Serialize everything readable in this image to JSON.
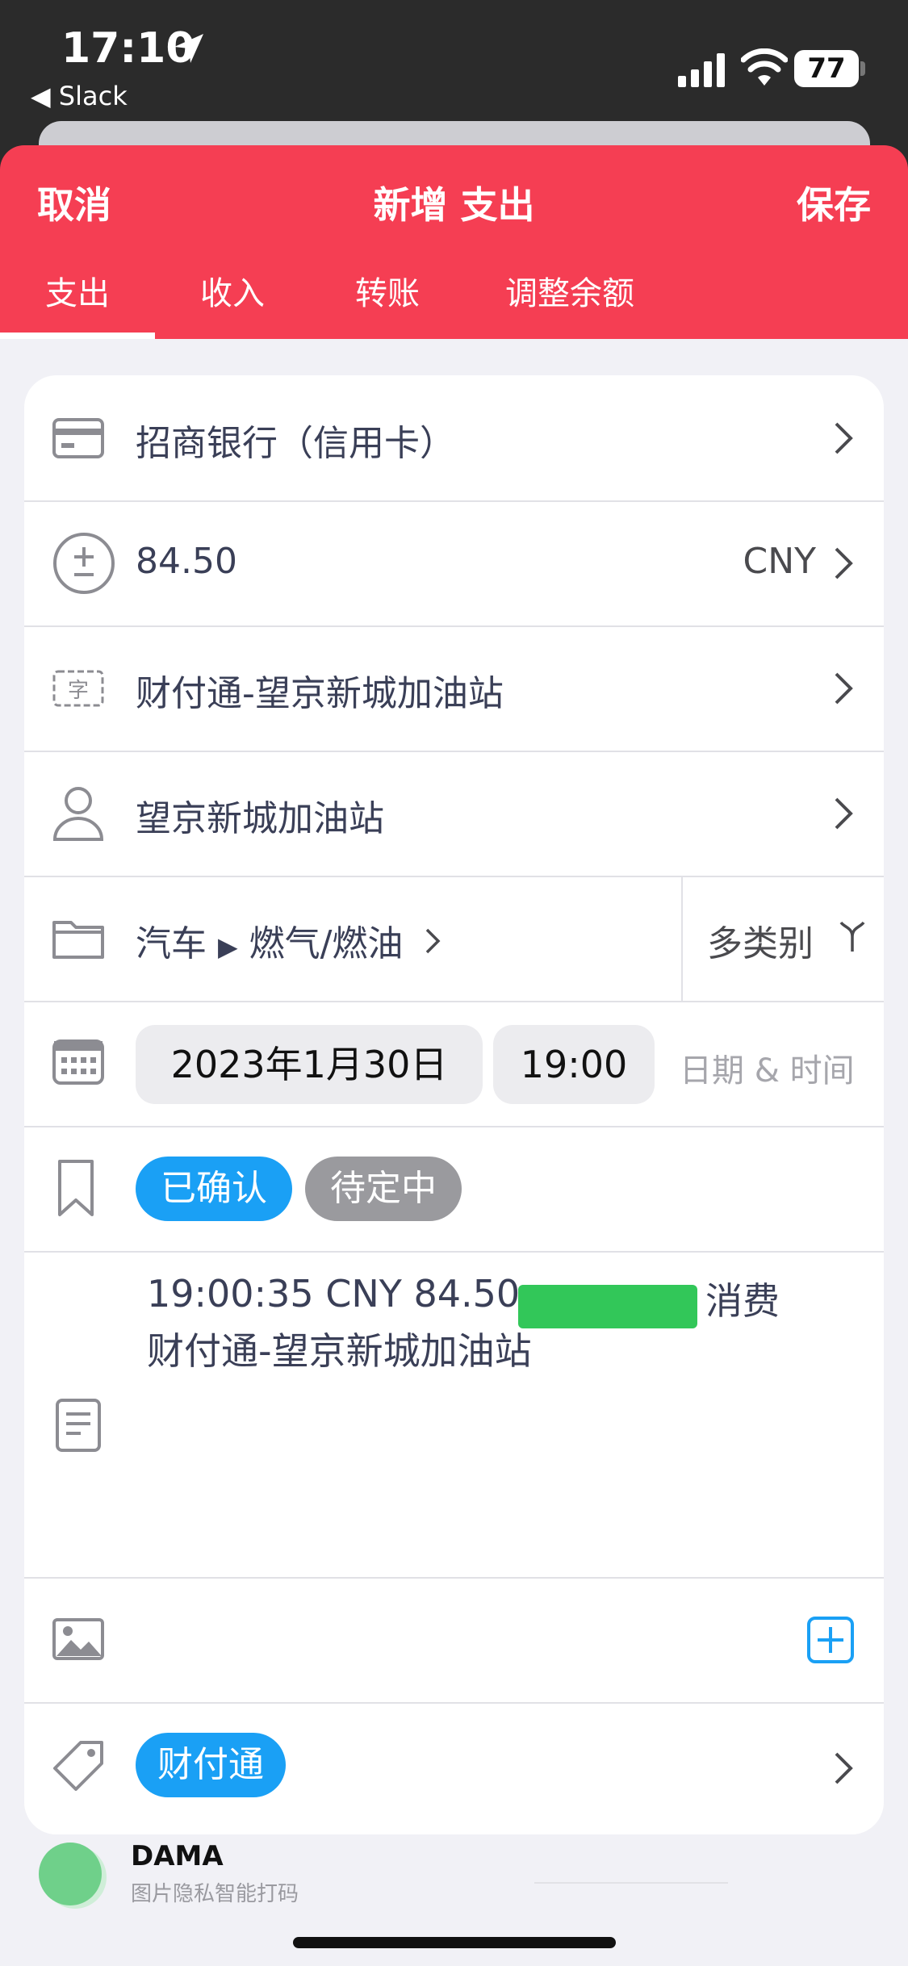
{
  "status_bar": {
    "time": "17:10",
    "back_app": "◀ Slack",
    "battery": "77"
  },
  "header": {
    "cancel_label": "取消",
    "title": "新增 支出",
    "save_label": "保存",
    "accent_color": "#f53e53"
  },
  "tabs": [
    {
      "label": "支出",
      "active": true
    },
    {
      "label": "收入",
      "active": false
    },
    {
      "label": "转账",
      "active": false
    },
    {
      "label": "调整余额",
      "active": false
    }
  ],
  "form": {
    "account": "招商银行（信用卡）",
    "amount": "84.50",
    "currency": "CNY",
    "description": "财付通-望京新城加油站",
    "payee": "望京新城加油站",
    "category": {
      "parent": "汽车",
      "separator": "▶",
      "child": "燃气/燃油",
      "multi_label": "多类别"
    },
    "date": "2023年1月30日",
    "time": "19:00",
    "date_time_label": "日期 & 时间",
    "status_tags": [
      {
        "label": "已确认",
        "color": "#1aa0f5"
      },
      {
        "label": "待定中",
        "color": "#9a9a9e"
      }
    ],
    "memo_line1_prefix": "19:00:35 CNY 84.50",
    "memo_line1_suffix": "消费",
    "memo_line2": "财付通-望京新城加油站",
    "tags": [
      {
        "label": "财付通",
        "color": "#1aa0f5"
      }
    ]
  },
  "icons": {
    "account": "credit-card-icon",
    "amount": "plus-minus-icon",
    "description": "text-label-icon",
    "payee": "person-icon",
    "category": "folder-icon",
    "date": "calendar-icon",
    "status": "bookmark-icon",
    "memo": "document-icon",
    "photo": "image-icon",
    "add_photo": "add-square-icon",
    "tags": "tag-icon",
    "description_glyph": "字"
  },
  "bottom_preview": {
    "title": "DAMA",
    "subtitle": "图片隐私智能打码"
  }
}
